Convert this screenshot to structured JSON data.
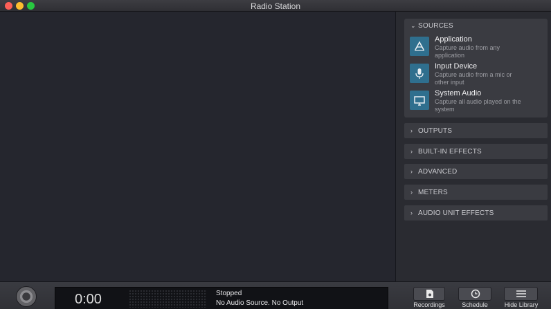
{
  "window": {
    "title": "Radio Station"
  },
  "sidebar": {
    "sources": {
      "header": "SOURCES",
      "items": [
        {
          "title": "Application",
          "description": "Capture audio from any application",
          "icon": "application-icon"
        },
        {
          "title": "Input Device",
          "description": "Capture audio from a mic or other input",
          "icon": "microphone-icon"
        },
        {
          "title": "System Audio",
          "description": "Capture all audio played on the system",
          "icon": "display-icon"
        }
      ]
    },
    "sections": [
      {
        "label": "OUTPUTS"
      },
      {
        "label": "BUILT-IN EFFECTS"
      },
      {
        "label": "ADVANCED"
      },
      {
        "label": "METERS"
      },
      {
        "label": "AUDIO UNIT EFFECTS"
      }
    ]
  },
  "status": {
    "timer": "0:00",
    "state": "Stopped",
    "detail": "No Audio Source. No Output"
  },
  "toolbar": {
    "recordings_label": "Recordings",
    "schedule_label": "Schedule",
    "library_label": "Hide Library"
  },
  "colors": {
    "traffic_close": "#fc5f57",
    "traffic_minimize": "#fdbc2e",
    "traffic_maximize": "#28c840",
    "source_icon_bg": "#2f6f8e"
  }
}
